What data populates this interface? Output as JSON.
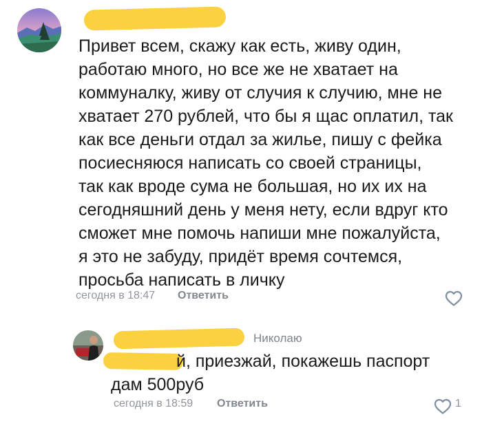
{
  "comment": {
    "text_lines": [
      "Привет всем, скажу как есть, живу один,",
      "работаю много, но все же не хватает на",
      "коммуналку, живу от случия к случию, мне не",
      "хватает 270 рублей, что бы я щас оплатил, так",
      "как все деньги отдал за жилье, пишу с фейка",
      "посиесняюся написать со своей страницы,",
      "так как вроде сума не большая, но их их на",
      "сегодняшний день у меня нету, если вдруг кто",
      "сможет мне помочь напиши мне пожалуйста,",
      "я это не забуду, придёт время сочтемся,",
      "просьба написать в личку"
    ],
    "time": "сегодня в 18:47",
    "reply_label": "Ответить"
  },
  "reply": {
    "to": "Николаю",
    "line1": "й, приезжай, покажешь паспорт",
    "line2": "дам 500руб",
    "time": "сегодня в 18:59",
    "reply_label": "Ответить",
    "likes": "1"
  },
  "colors": {
    "censor": "#fcd13f",
    "meta": "#8f959b",
    "like_icon": "#7f8ea0"
  }
}
